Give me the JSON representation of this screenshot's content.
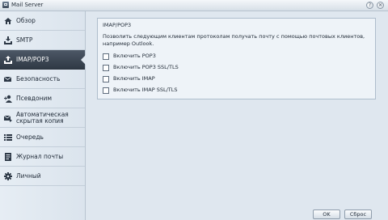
{
  "window": {
    "title": "Mail Server",
    "help_glyph": "?",
    "close_glyph": "✕"
  },
  "sidebar": {
    "items": [
      {
        "label": "Обзор",
        "icon": "house-icon",
        "active": false
      },
      {
        "label": "SMTP",
        "icon": "download-tray-icon",
        "active": false
      },
      {
        "label": "IMAP/POP3",
        "icon": "upload-tray-icon",
        "active": true
      },
      {
        "label": "Безопасность",
        "icon": "envelope-shield-icon",
        "active": false
      },
      {
        "label": "Псевдоним",
        "icon": "user-add-icon",
        "active": false
      },
      {
        "label": "Автоматическая скрытая копия",
        "icon": "envelope-arrow-icon",
        "active": false
      },
      {
        "label": "Очередь",
        "icon": "list-icon",
        "active": false
      },
      {
        "label": "Журнал почты",
        "icon": "document-icon",
        "active": false
      },
      {
        "label": "Личный",
        "icon": "gear-icon",
        "active": false
      }
    ]
  },
  "main": {
    "group_title": "IMAP/POP3",
    "description": "Позволить следующим клиентам протоколам получать почту с помощью почтовых клиентов, например Outlook.",
    "options": [
      {
        "label": "Включить POP3",
        "checked": false
      },
      {
        "label": "Включить POP3 SSL/TLS",
        "checked": false
      },
      {
        "label": "Включить IMAP",
        "checked": false
      },
      {
        "label": "Включить IMAP SSL/TLS",
        "checked": false
      }
    ]
  },
  "footer": {
    "ok_label": "OK",
    "cancel_label": "Сброс"
  },
  "colors": {
    "active_bg": "#3a4552",
    "panel_bg": "#dfe7ef",
    "group_border": "#aebdcc"
  }
}
